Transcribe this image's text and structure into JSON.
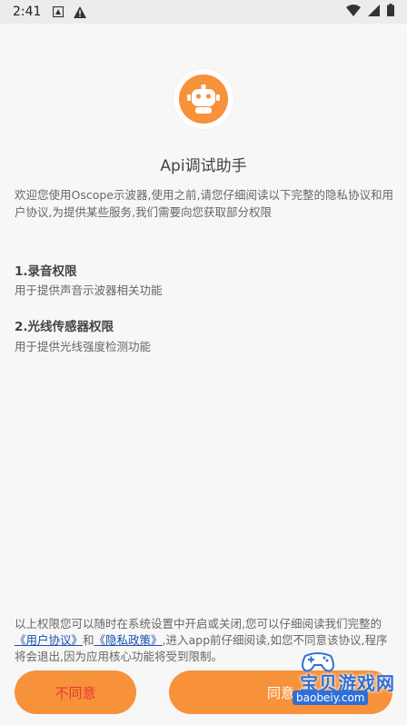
{
  "status": {
    "time": "2:41"
  },
  "app": {
    "title": "Api调试助手",
    "accent": "#f7913a"
  },
  "intro": "欢迎您使用Oscope示波器,使用之前,请您仔细阅读以下完整的隐私协议和用户协议,为提供某些服务,我们需要向您获取部分权限",
  "permissions": [
    {
      "title": "1.录音权限",
      "desc": "用于提供声音示波器相关功能"
    },
    {
      "title": "2.光线传感器权限",
      "desc": "用于提供光线强度检测功能"
    }
  ],
  "footer": {
    "part1": "以上权限您可以随时在系统设置中开启或关闭,您可以仔细阅读我们完整的",
    "user_agreement": "《用户协议》",
    "and": "和",
    "privacy_policy": "《隐私政策》",
    "part2": ",进入app前仔细阅读,如您不同意该协议,程序将会退出,因为应用核心功能将受到限制。"
  },
  "buttons": {
    "disagree": "不同意",
    "agree": "同意"
  },
  "watermark": {
    "text": "宝贝游戏网",
    "url": "baobeiy.com"
  }
}
